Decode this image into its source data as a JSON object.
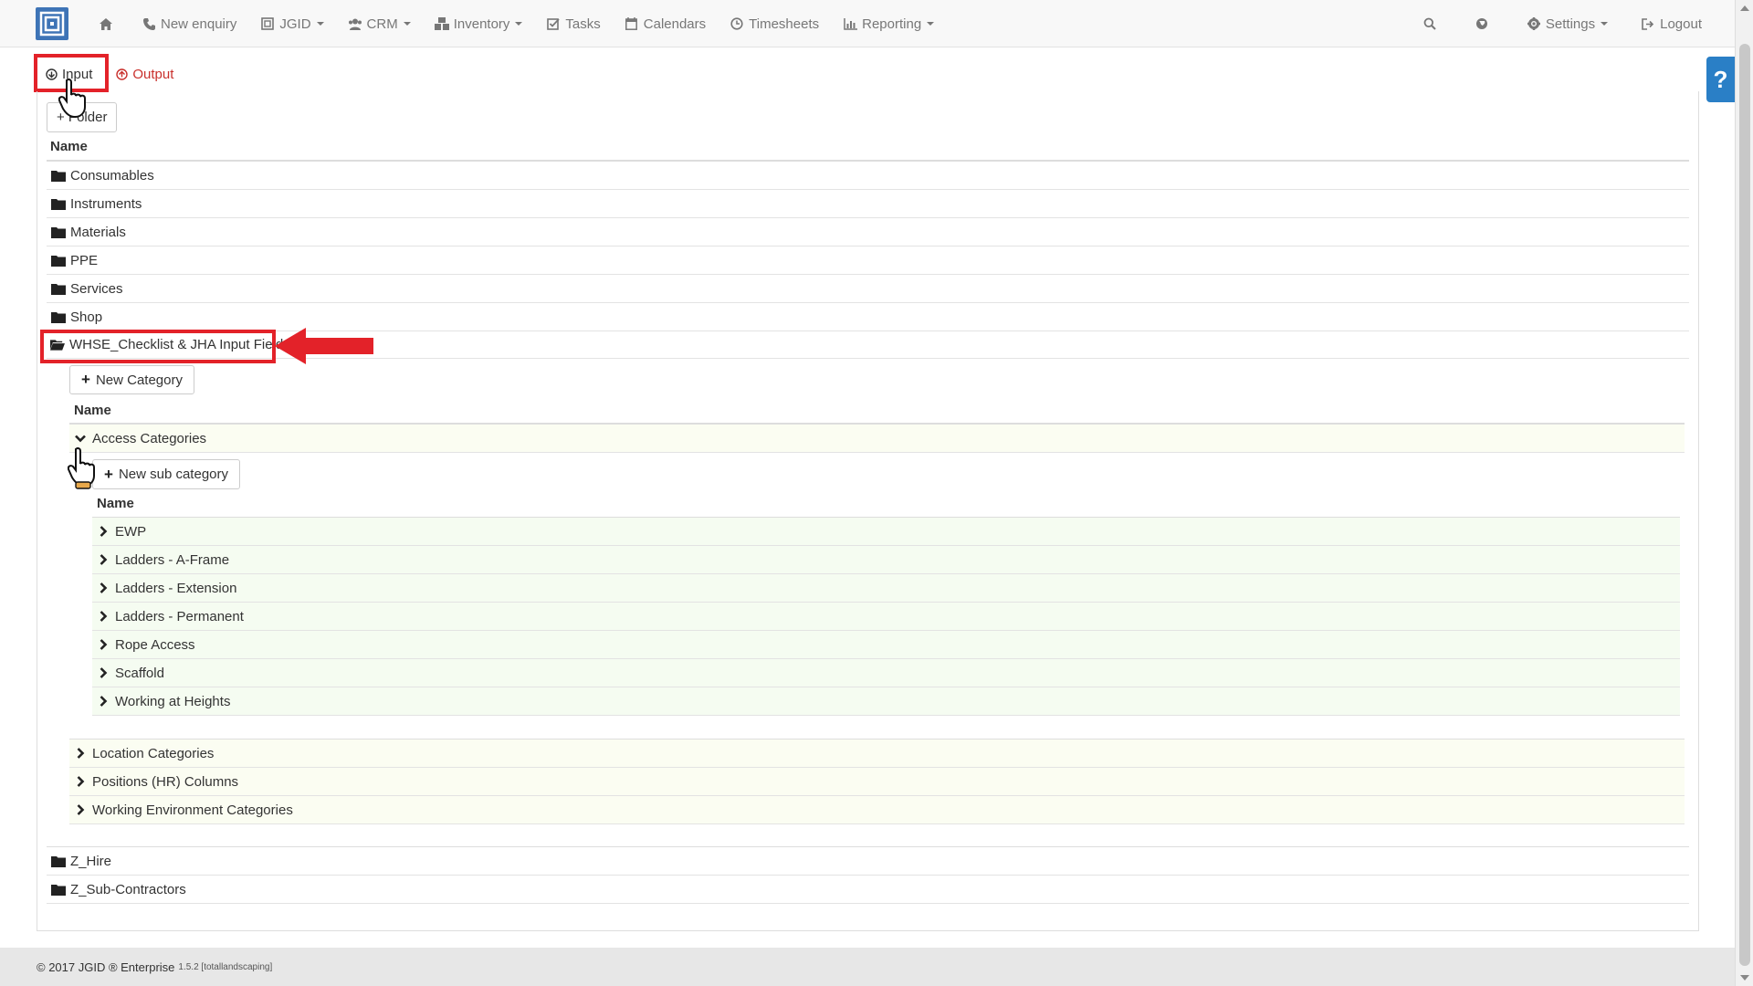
{
  "navbar": {
    "home_icon": "home-icon",
    "items": [
      {
        "label": "New enquiry",
        "icon": "phone-icon",
        "dropdown": false
      },
      {
        "label": "JGID",
        "icon": "jgid-icon",
        "dropdown": true
      },
      {
        "label": "CRM",
        "icon": "users-icon",
        "dropdown": true
      },
      {
        "label": "Inventory",
        "icon": "cubes-icon",
        "dropdown": true
      },
      {
        "label": "Tasks",
        "icon": "check-square-icon",
        "dropdown": false
      },
      {
        "label": "Calendars",
        "icon": "calendar-icon",
        "dropdown": false
      },
      {
        "label": "Timesheets",
        "icon": "clock-icon",
        "dropdown": false
      },
      {
        "label": "Reporting",
        "icon": "bar-chart-icon",
        "dropdown": true
      }
    ],
    "right": {
      "settings_label": "Settings",
      "logout_label": "Logout"
    }
  },
  "help": {
    "label": "?"
  },
  "tabs": {
    "input_label": "Input",
    "output_label": "Output"
  },
  "folders": {
    "new_folder_label": "+ Folder",
    "name_header": "Name",
    "items_top": [
      "Consumables",
      "Instruments",
      "Materials",
      "PPE",
      "Services",
      "Shop"
    ],
    "open_folder": "WHSE_Checklist & JHA Input Fields",
    "items_bottom": [
      "Z_Hire",
      "Z_Sub-Contractors"
    ]
  },
  "categories": {
    "new_category_label": "New Category",
    "name_header": "Name",
    "open_category": "Access Categories",
    "others": [
      "Location Categories",
      "Positions (HR) Columns",
      "Working Environment Categories"
    ]
  },
  "subcategories": {
    "new_sub_label": "New sub category",
    "name_header": "Name",
    "items": [
      "EWP",
      "Ladders - A-Frame",
      "Ladders - Extension",
      "Ladders - Permanent",
      "Rope Access",
      "Scaffold",
      "Working at Heights"
    ]
  },
  "footer": {
    "copyright": "© 2017 JGID ® Enterprise",
    "version": "1.5.2 [totallandscaping]"
  },
  "colors": {
    "accent_red": "#e32229",
    "brand_blue": "#3e74b6",
    "help_blue": "#2a7fc6",
    "row_green": "#f5fcf1"
  }
}
